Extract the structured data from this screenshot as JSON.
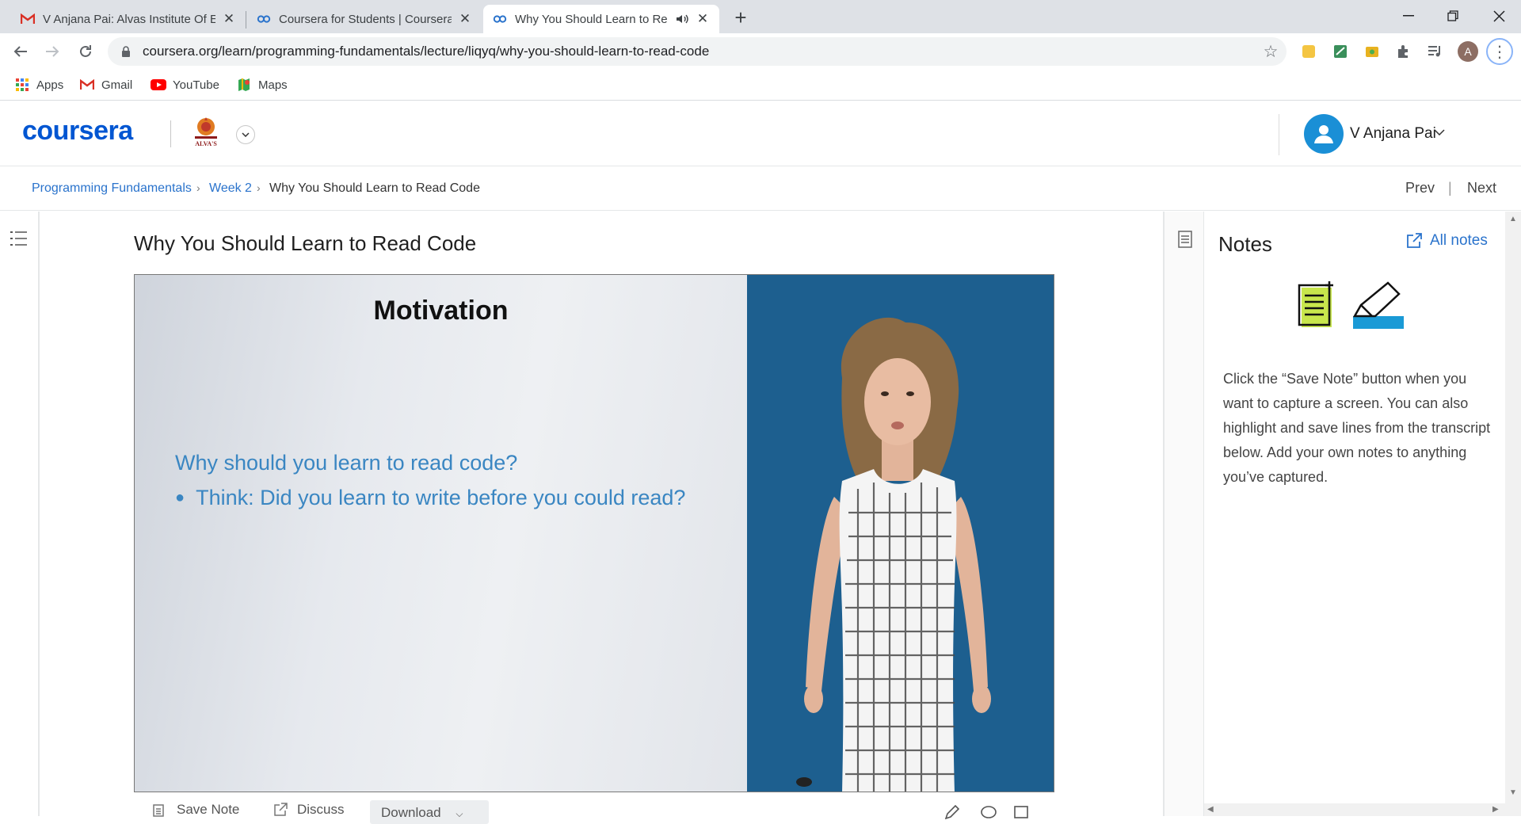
{
  "browser": {
    "tabs": [
      {
        "title": "V Anjana Pai: Alvas Institute Of En",
        "favicon": "gmail-icon",
        "active": false
      },
      {
        "title": "Coursera for Students | Coursera",
        "favicon": "coursera-icon",
        "active": false
      },
      {
        "title": "Why You Should Learn to Re",
        "favicon": "coursera-icon",
        "active": true,
        "audio": true
      }
    ],
    "url": "coursera.org/learn/programming-fundamentals/lecture/liqyq/why-you-should-learn-to-read-code",
    "profile_initial": "A",
    "bookmarks": [
      "Apps",
      "Gmail",
      "YouTube",
      "Maps"
    ]
  },
  "header": {
    "logo": "coursera",
    "institution_logo_text": "ALVA'S",
    "user_name": "V Anjana Pai"
  },
  "breadcrumb": {
    "items": [
      "Programming Fundamentals",
      "Week 2",
      "Why You Should Learn to Read Code"
    ],
    "prev": "Prev",
    "next": "Next"
  },
  "lecture": {
    "title": "Why You Should Learn to Read Code",
    "slide": {
      "heading": "Motivation",
      "question": "Why should you learn to read code?",
      "bullet": "Think: Did you learn to write before you could read?"
    },
    "controls": {
      "save_note": "Save Note",
      "discuss": "Discuss",
      "download": "Download"
    }
  },
  "notes": {
    "title": "Notes",
    "all_notes": "All notes",
    "help_text": "Click the “Save Note” button when you want to capture a screen. You can also highlight and save lines from the transcript below. Add your own notes to anything you’ve captured."
  },
  "colors": {
    "brand": "#0056d2",
    "link": "#2a73cc",
    "slide_text": "#3a86c2",
    "presenter_bg": "#1d5f8f"
  }
}
